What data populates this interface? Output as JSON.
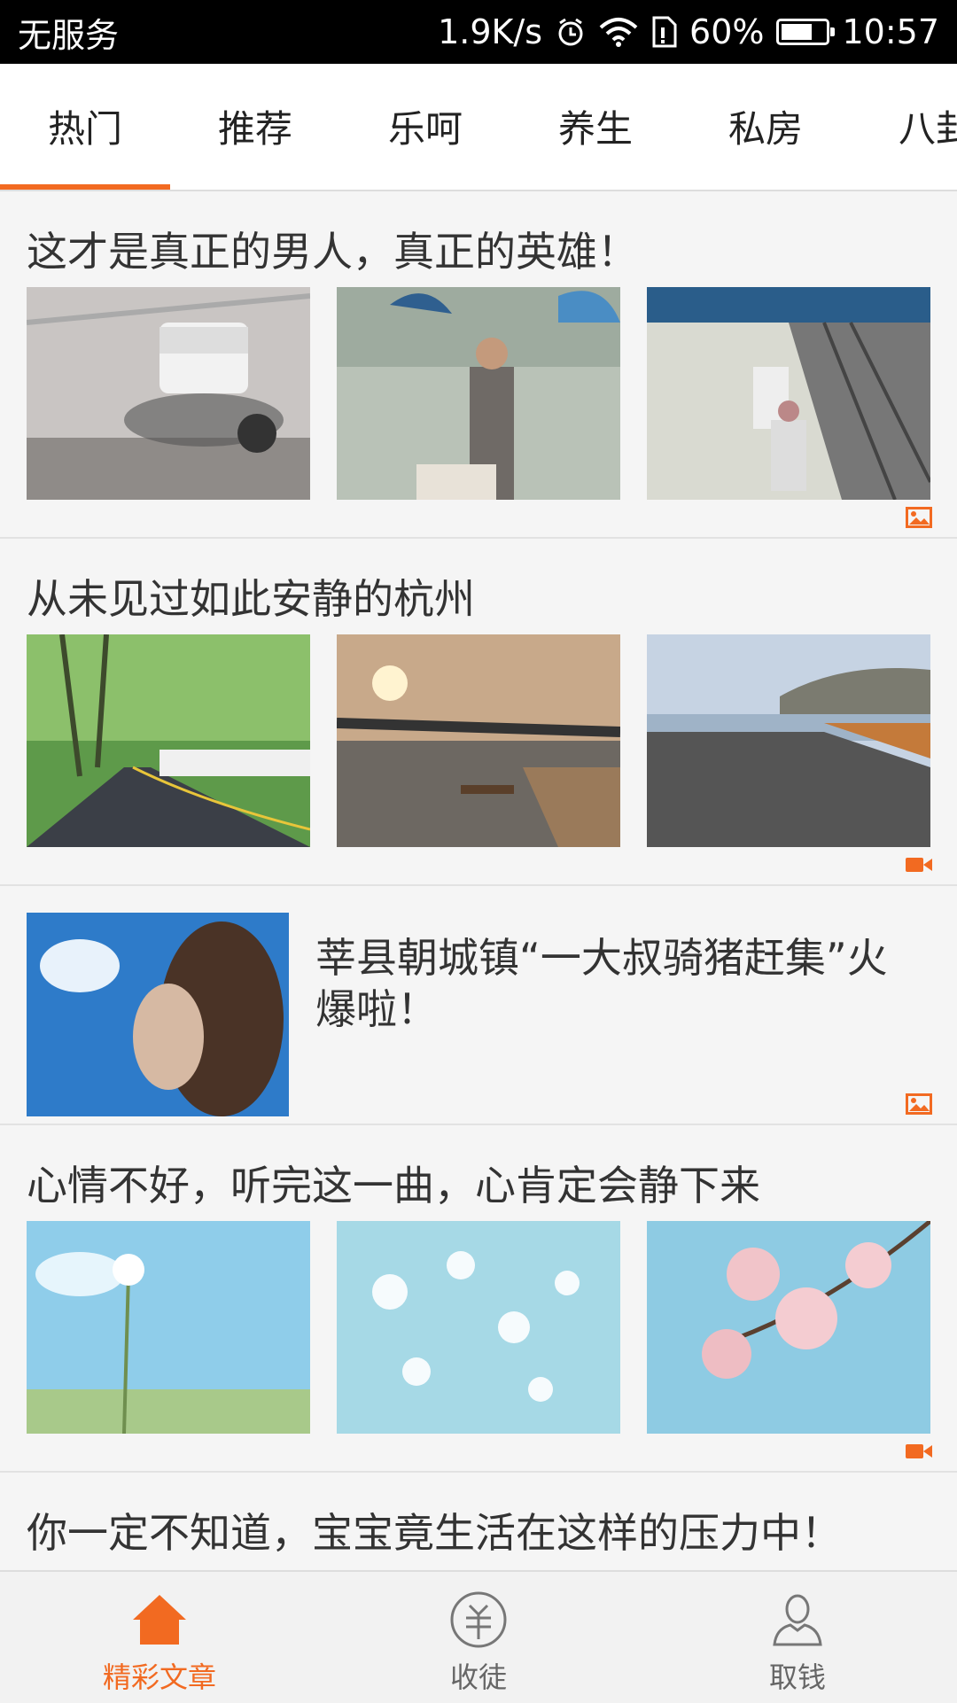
{
  "status_bar": {
    "carrier": "无服务",
    "speed": "1.9K/s",
    "battery": "60%",
    "time": "10:57"
  },
  "tabs": [
    {
      "label": "热门",
      "active": true
    },
    {
      "label": "推荐",
      "active": false
    },
    {
      "label": "乐呵",
      "active": false
    },
    {
      "label": "养生",
      "active": false
    },
    {
      "label": "私房",
      "active": false
    },
    {
      "label": "八卦",
      "active": false
    }
  ],
  "articles": [
    {
      "title": "这才是真正的男人，真正的英雄！",
      "layout": "three-images",
      "type_icon": "image-icon"
    },
    {
      "title": "从未见过如此安静的杭州",
      "layout": "three-images",
      "type_icon": "video-icon"
    },
    {
      "title": "莘县朝城镇“一大叔骑猪赶集”火爆啦！",
      "layout": "single-image",
      "type_icon": "image-icon"
    },
    {
      "title": "心情不好，听完这一曲，心肯定会静下来",
      "layout": "three-images",
      "type_icon": "video-icon"
    },
    {
      "title": "你一定不知道，宝宝竟生活在这样的压力中！",
      "layout": "title-only"
    }
  ],
  "bottom_nav": [
    {
      "label": "精彩文章",
      "icon": "home-icon",
      "active": true
    },
    {
      "label": "收徒",
      "icon": "coin-icon",
      "active": false
    },
    {
      "label": "取钱",
      "icon": "user-icon",
      "active": false
    }
  ],
  "colors": {
    "accent": "#f26a21",
    "background": "#f5f5f5",
    "status_bar": "#000000"
  }
}
